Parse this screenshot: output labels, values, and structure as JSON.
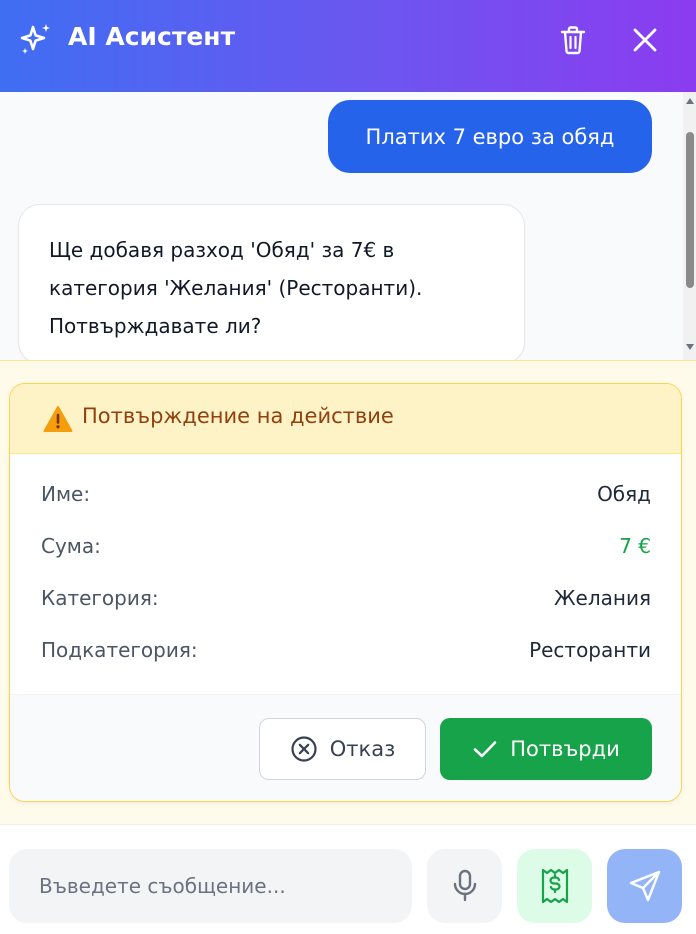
{
  "header": {
    "title": "AI Асистент",
    "icons": {
      "brand": "sparkles-icon",
      "delete": "trash-icon",
      "close": "close-icon"
    }
  },
  "chat": {
    "messages": [
      {
        "role": "user",
        "text": "Платих 7 евро за обяд"
      },
      {
        "role": "assistant",
        "text": "Ще добавя разход 'Обяд' за 7€ в категория 'Желания' (Ресторанти). Потвърждавате ли?"
      }
    ]
  },
  "confirmation": {
    "title": "Потвърждение на действие",
    "fields": [
      {
        "label": "Име:",
        "value": "Обяд"
      },
      {
        "label": "Сума:",
        "value": "7 €"
      },
      {
        "label": "Категория:",
        "value": "Желания"
      },
      {
        "label": "Подкатегория:",
        "value": "Ресторанти"
      }
    ],
    "cancel_label": "Отказ",
    "confirm_label": "Потвърди"
  },
  "input": {
    "placeholder": "Въведете съобщение..."
  },
  "colors": {
    "header_gradient_start": "#3f6ef3",
    "header_gradient_end": "#8b3cf0",
    "user_bubble": "#2563eb",
    "amount_green": "#16a34a",
    "confirm_button": "#16a34a",
    "warning_bg": "#fef3c7",
    "warning_text": "#92400e"
  }
}
